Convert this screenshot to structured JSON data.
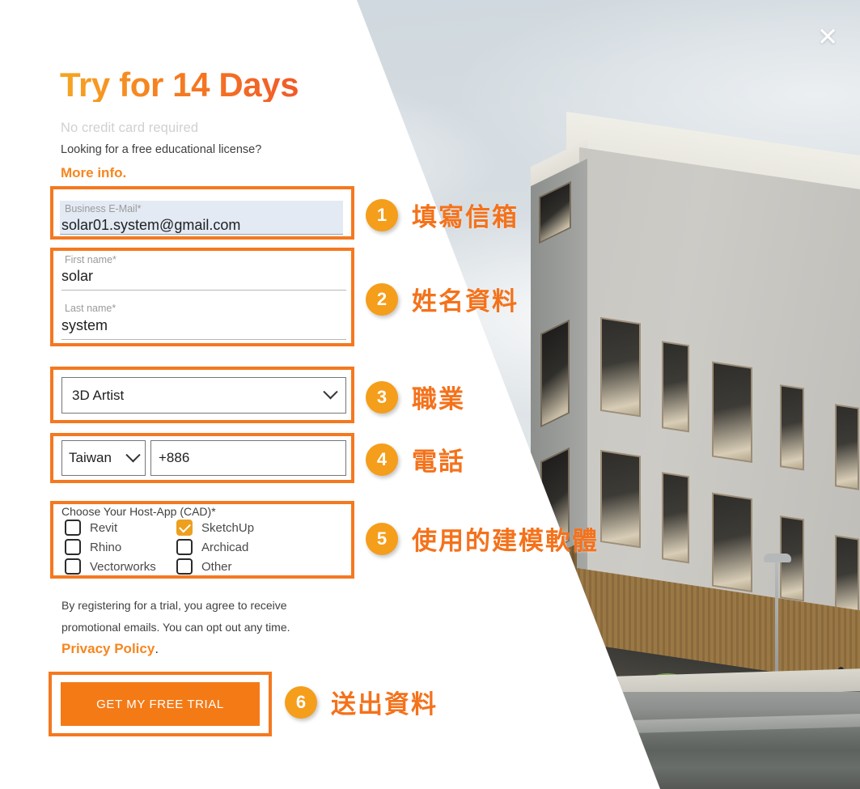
{
  "modal": {
    "close_icon": "close-icon",
    "headline": "Try for 14 Days",
    "subhead": "No credit card required",
    "edu_question": "Looking for a free educational license?",
    "more_info": "More info."
  },
  "form": {
    "email": {
      "label": "Business E-Mail*",
      "value": "solar01.system@gmail.com",
      "placeholder": "Business E-Mail*"
    },
    "first_name": {
      "label": "First name*",
      "value": "solar",
      "placeholder": "First name*"
    },
    "last_name": {
      "label": "Last name*",
      "value": "system",
      "placeholder": "Last name*"
    },
    "occupation": {
      "value": "3D Artist",
      "options": [
        "3D Artist"
      ]
    },
    "phone": {
      "country": "Taiwan",
      "country_options": [
        "Taiwan"
      ],
      "number": "+886",
      "number_placeholder": "+886"
    },
    "host_app": {
      "label": "Choose Your Host-App (CAD)*",
      "options": [
        {
          "label": "Revit",
          "checked": false
        },
        {
          "label": "SketchUp",
          "checked": true
        },
        {
          "label": "Rhino",
          "checked": false
        },
        {
          "label": "Archicad",
          "checked": false
        },
        {
          "label": "Vectorworks",
          "checked": false
        },
        {
          "label": "Other",
          "checked": false
        }
      ]
    },
    "legal_text": "By registering for a trial, you agree to receive promotional emails. You can opt out any time.",
    "privacy_link": "Privacy Policy",
    "privacy_period": ".",
    "submit_label": "GET MY FREE TRIAL"
  },
  "steps": [
    {
      "number": "1",
      "text": "填寫信箱"
    },
    {
      "number": "2",
      "text": "姓名資料"
    },
    {
      "number": "3",
      "text": "職業"
    },
    {
      "number": "4",
      "text": "電話"
    },
    {
      "number": "5",
      "text": "使用的建模軟體"
    },
    {
      "number": "6",
      "text": "送出資料"
    }
  ],
  "colors": {
    "accent_orange": "#F47920",
    "badge_orange": "#F49E1B",
    "annotation_orange": "#F4721B",
    "submit_orange": "#F47A16",
    "checkbox_checked": "#EDA01E",
    "headline_gradient_from": "#F6A623",
    "headline_gradient_to": "#F15A29",
    "autofill_bg": "#E3EAF4"
  }
}
